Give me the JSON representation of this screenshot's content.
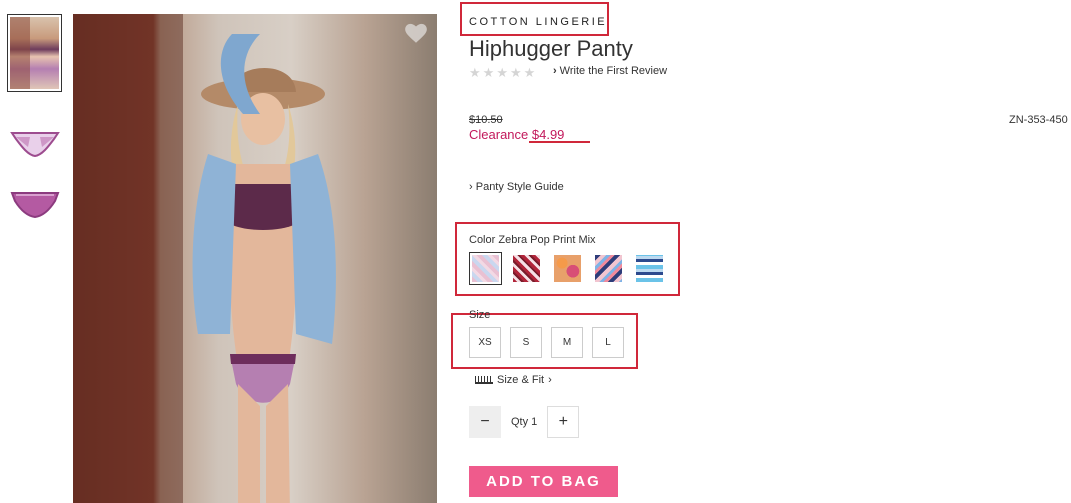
{
  "product": {
    "collection": "COTTON LINGERIE",
    "title": "Hiphugger Panty",
    "review_link": "Write the First Review",
    "original_price": "$10.50",
    "sale_price": "Clearance $4.99",
    "sku": "ZN-353-450",
    "style_guide": "Panty Style Guide",
    "color_prefix": "Color",
    "color_name": "Zebra Pop Print Mix",
    "size_label": "Size",
    "sizes": [
      "XS",
      "S",
      "M",
      "L"
    ],
    "size_fit": "Size & Fit",
    "qty_label": "Qty 1",
    "minus": "−",
    "plus": "+",
    "add_to_bag": "ADD TO BAG"
  },
  "icons": {
    "favorite": "heart-icon",
    "stars": "star-icon",
    "review_chevron": "chevron-right-icon",
    "style_chevron": "chevron-right-icon",
    "size_fit_ruler": "ruler-icon",
    "size_fit_chevron": "chevron-right-icon"
  },
  "rating": {
    "stars_filled": 0,
    "stars_total": 5
  },
  "colors": {
    "accent_sale": "#c2185b",
    "add_button": "#ef5b8c",
    "highlight_box": "#d0283a"
  }
}
